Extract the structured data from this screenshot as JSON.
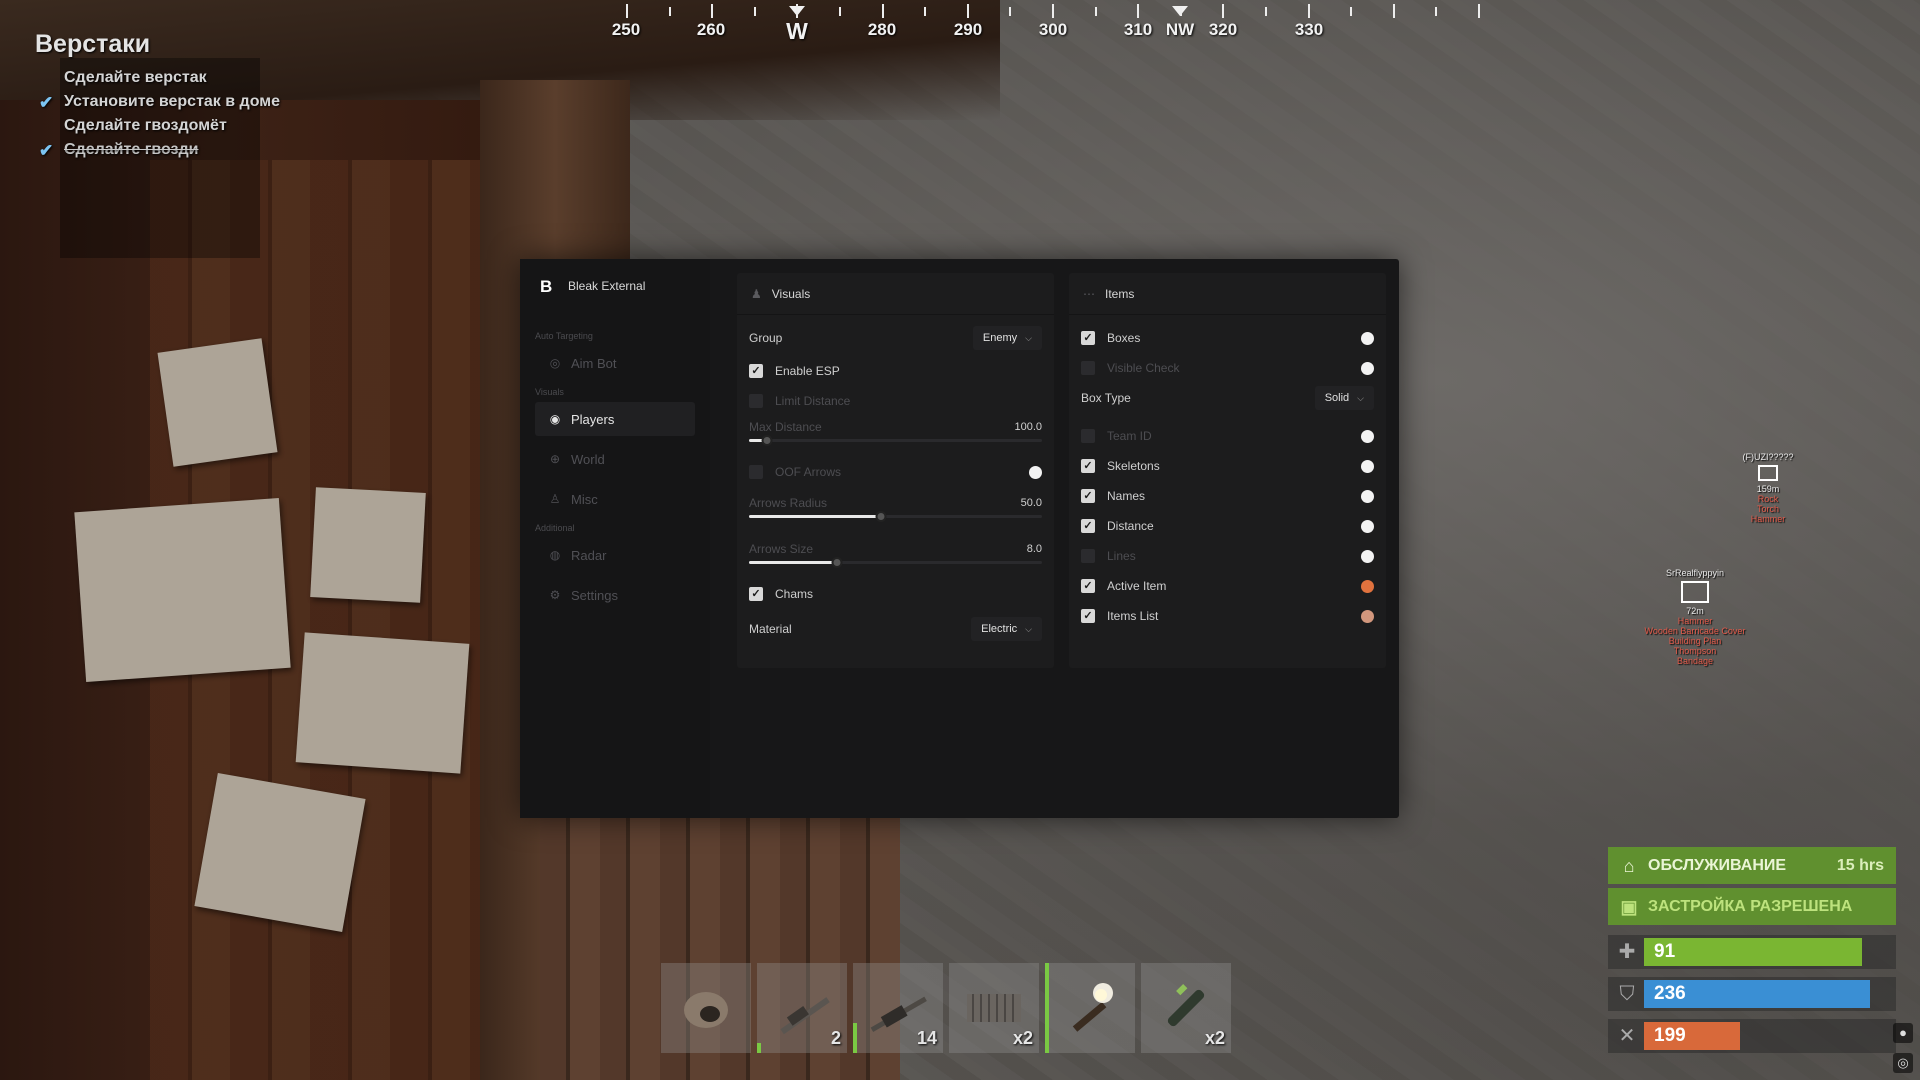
{
  "tasks": {
    "title": "Верстаки",
    "items": [
      {
        "label": "Сделайте верстак",
        "done": false
      },
      {
        "label": "Установите верстак в доме",
        "done": true
      },
      {
        "label": "Сделайте гвоздомёт",
        "done": false
      },
      {
        "label": "Сделайте гвозди",
        "done": true
      }
    ]
  },
  "compass": {
    "labels": [
      "250",
      "260",
      "W",
      "280",
      "290",
      "300",
      "310",
      "NW",
      "320",
      "330"
    ]
  },
  "menu": {
    "brand": "Bleak External",
    "brand_logo": "B",
    "sections": {
      "auto_targeting": "Auto Targeting",
      "visuals": "Visuals",
      "additional": "Additional"
    },
    "nav": {
      "aimbot": "Aim Bot",
      "players": "Players",
      "world": "World",
      "misc": "Misc",
      "radar": "Radar",
      "settings": "Settings"
    },
    "visuals": {
      "title": "Visuals",
      "group_label": "Group",
      "group_value": "Enemy",
      "enable_esp": "Enable ESP",
      "limit_distance": "Limit Distance",
      "max_distance_label": "Max Distance",
      "max_distance_value": "100.0",
      "max_distance_fraction": 0.06,
      "oof_arrows": "OOF Arrows",
      "arrows_radius_label": "Arrows Radius",
      "arrows_radius_value": "50.0",
      "arrows_radius_fraction": 0.45,
      "arrows_size_label": "Arrows Size",
      "arrows_size_value": "8.0",
      "arrows_size_fraction": 0.3,
      "chams": "Chams",
      "material_label": "Material",
      "material_value": "Electric"
    },
    "items": {
      "title": "Items",
      "boxes": "Boxes",
      "visible_check": "Visible Check",
      "box_type_label": "Box Type",
      "box_type_value": "Solid",
      "team_id": "Team ID",
      "skeletons": "Skeletons",
      "names": "Names",
      "distance": "Distance",
      "lines": "Lines",
      "active_item": "Active Item",
      "items_list": "Items List",
      "active_item_color": "#e0723e",
      "items_list_color": "#d2977d"
    }
  },
  "esp": {
    "player1": {
      "name": "(F)UZI?????",
      "distance": "159m",
      "items": [
        "Rock",
        "Torch",
        "Hammer"
      ]
    },
    "player2": {
      "name": "SrRealflyppyin",
      "distance": "72m",
      "items": [
        "Hammer",
        "Wooden Barricade Cover",
        "Building Plan",
        "Thompson",
        "Bandage"
      ]
    }
  },
  "status": {
    "maintenance_label": "ОБСЛУЖИВАНИЕ",
    "maintenance_time": "15 hrs",
    "building_label": "ЗАСТРОЙКА РАЗРЕШЕНА"
  },
  "vitals": {
    "health": "91",
    "health_fraction": 0.91,
    "water": "236",
    "water_fraction": 0.94,
    "food": "199",
    "food_fraction": 0.4,
    "health_color": "#7ab632",
    "water_color": "#3a8fd4",
    "food_color": "#d8693a"
  },
  "hotbar": [
    {
      "qty": "",
      "icon": "rock-icon"
    },
    {
      "qty": "2",
      "icon": "weapon-icon"
    },
    {
      "qty": "14",
      "icon": "rifle-icon"
    },
    {
      "qty": "x2",
      "icon": "nails-icon"
    },
    {
      "qty": "",
      "icon": "torch-icon"
    },
    {
      "qty": "x2",
      "icon": "syringe-icon"
    }
  ]
}
